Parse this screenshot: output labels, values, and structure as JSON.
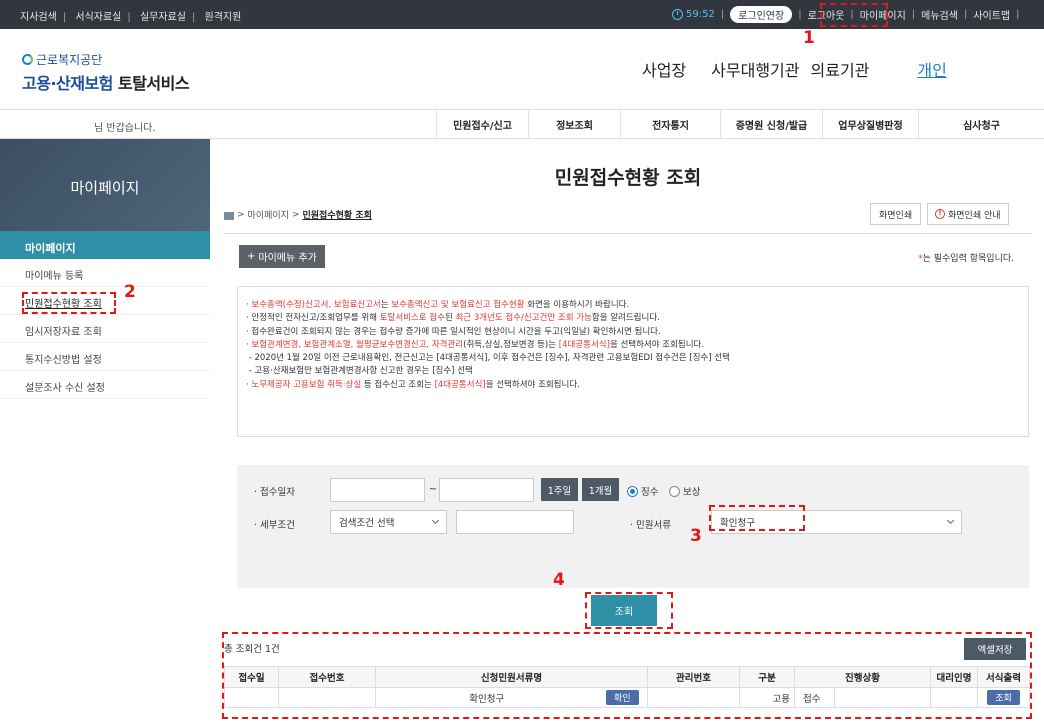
{
  "topbar": {
    "left_links": [
      "지사검색",
      "서식자료실",
      "실무자료실",
      "원격지원"
    ],
    "timer": "59:52",
    "extend_label": "로그인연장",
    "logout": "로그아웃",
    "mypage": "마이페이지",
    "menu_search": "메뉴검색",
    "sitemap": "사이트맵"
  },
  "header": {
    "logo_top": "근로복지공단",
    "logo_blue": "고용·산재보험",
    "logo_dark": "토탈서비스",
    "user_types": [
      "사업장",
      "사무대행기관",
      "의료기관",
      "개인"
    ]
  },
  "menubar": {
    "greeting": "님 반갑습니다.",
    "items": [
      "민원접수/신고",
      "정보조회",
      "전자통지",
      "증명원 신청/발급",
      "업무상질병판정",
      "심사청구"
    ]
  },
  "sidebar": {
    "heading": "마이페이지",
    "section": "마이페이지",
    "items": [
      "마이메뉴 등록",
      "민원접수현황 조회",
      "임시저장자료 조회",
      "통지수신방법 설정",
      "설문조사 수신 설정"
    ]
  },
  "main": {
    "title": "민원접수현황 조회",
    "breadcrumb": [
      "마이페이지",
      "민원접수현황 조회"
    ],
    "print_label": "화면인쇄",
    "print_guide_label": "화면인쇄 안내",
    "add_menu_label": "마이메뉴 추가",
    "required_star": "*",
    "required_note": "는 필수입력 항목입니다.",
    "notice": {
      "l1_red1": "보수총액(수정)신고서, 보험료신고서",
      "l1_t1": "는 ",
      "l1_red2": "보수총액신고 및 보험료신고 접수현황",
      "l1_t2": " 화면을 이용하시기 바랍니다.",
      "l2_t1": "안정적인 전자신고/조회업무를 위해 ",
      "l2_red1": "토탈서비스로 접수",
      "l2_t2": "된 ",
      "l2_red2": "최근 3개년도 접수/신고건만 조회 가능",
      "l2_t3": "함을 알려드립니다.",
      "l3": "접수완료건이 조회되지 않는 경우는 접수량 증가에 따른 일시적인 현상이니 시간을 두고(익일날) 확인하시면 됩니다.",
      "l4_red1": "보험관계변경, 보험관계소멸, 월평균보수변경신고, 자격관리",
      "l4_t1": "(취득,상실,정보변경 등)는 ",
      "l4_red2": "[4대공통서식]",
      "l4_t2": "을 선택하셔야 조회됩니다.",
      "l5": "- 2020년 1월 20일 이전 근로내용확인, 전근신고는 [4대공통서식], 이후 접수건은 [징수], 자격관련 고용보험EDI 접수건은 [징수] 선택",
      "l6": "- 고용·산재보험만 보험관계변경사항 신고한 경우는 [징수] 선택",
      "l7_red1": "노무제공자 고용보험 취득·상실",
      "l7_t1": " 등 접수신고 조회는 ",
      "l7_red2": "[4대공통서식]",
      "l7_t2": "을 선택하셔야 조회됩니다."
    },
    "search": {
      "date_label": "접수일자",
      "tilde": "~",
      "week_btn": "1주일",
      "month_btn": "1개월",
      "radio_collect": "징수",
      "radio_comp": "보상",
      "detail_label": "세부조건",
      "detail_select": "검색조건 선택",
      "doc_label": "민원서류",
      "doc_value": "확인청구",
      "search_btn": "조회"
    },
    "results": {
      "total": "총 조회건 1건",
      "excel_btn": "엑셀저장",
      "columns": [
        "접수일",
        "접수번호",
        "신청민원서류명",
        "관리번호",
        "구분",
        "진행상황",
        "대리인명",
        "서식출력"
      ],
      "row": {
        "date": "",
        "number": "",
        "doc_name": "확인청구",
        "confirm_btn": "확인",
        "manage_no": "",
        "type": "고용",
        "status": "접수",
        "agent": "",
        "print_btn": "조회"
      }
    }
  },
  "annotations": {
    "n1": "1",
    "n2": "2",
    "n3": "3",
    "n4": "4",
    "color": "#e01818"
  }
}
